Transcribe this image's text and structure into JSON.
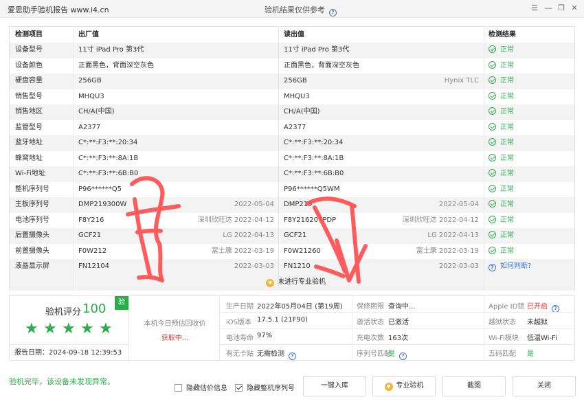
{
  "window": {
    "title": "爱思助手验机报告 www.i4.cn",
    "center_text": "验机结果仅供参考"
  },
  "table": {
    "headers": [
      "检测项目",
      "出厂值",
      "读出值",
      "检测结果"
    ],
    "rows": [
      {
        "item": "设备型号",
        "factory": "11寸 iPad Pro 第3代",
        "factory_sub": "",
        "read": "11寸 iPad Pro 第3代",
        "read_sub": "",
        "result": "正常",
        "status": "ok"
      },
      {
        "item": "设备颜色",
        "factory": "正面黑色，背面深空灰色",
        "factory_sub": "",
        "read": "正面黑色，背面深空灰色",
        "read_sub": "",
        "result": "正常",
        "status": "ok"
      },
      {
        "item": "硬盘容量",
        "factory": "256GB",
        "factory_sub": "",
        "read": "256GB",
        "read_sub": "Hynix TLC",
        "result": "正常",
        "status": "ok"
      },
      {
        "item": "销售型号",
        "factory": "MHQU3",
        "factory_sub": "",
        "read": "MHQU3",
        "read_sub": "",
        "result": "正常",
        "status": "ok"
      },
      {
        "item": "销售地区",
        "factory": "CH/A(中国)",
        "factory_sub": "",
        "read": "CH/A(中国)",
        "read_sub": "",
        "result": "正常",
        "status": "ok"
      },
      {
        "item": "监管型号",
        "factory": "A2377",
        "factory_sub": "",
        "read": "A2377",
        "read_sub": "",
        "result": "正常",
        "status": "ok"
      },
      {
        "item": "蓝牙地址",
        "factory": "C*:**:F3:**:20:34",
        "factory_sub": "",
        "read": "C*:**:F3:**:20:34",
        "read_sub": "",
        "result": "正常",
        "status": "ok"
      },
      {
        "item": "蜂窝地址",
        "factory": "C*:**:F3:**:8A:1B",
        "factory_sub": "",
        "read": "C*:**:F3:**:8A:1B",
        "read_sub": "",
        "result": "正常",
        "status": "ok"
      },
      {
        "item": "Wi-Fi地址",
        "factory": "C*:**:F3:**:6B:B0",
        "factory_sub": "",
        "read": "C*:**:F3:**:6B:B0",
        "read_sub": "",
        "result": "正常",
        "status": "ok"
      },
      {
        "item": "整机序列号",
        "factory": "P96******Q5",
        "factory_sub": "",
        "read": "P96******Q5WM",
        "read_sub": "",
        "result": "正常",
        "status": "ok"
      },
      {
        "item": "主板序列号",
        "factory": "DMP219300W",
        "factory_sub": "2022-05-04",
        "read": "DMP219",
        "read_sub": "2022-05-04",
        "result": "正常",
        "status": "ok"
      },
      {
        "item": "电池序列号",
        "factory": "F8Y216",
        "factory_sub": "深圳欣旺达 2022-04-12",
        "read": "F8Y216207PDP",
        "read_sub": "深圳欣旺达 2022-04-12",
        "result": "正常",
        "status": "ok"
      },
      {
        "item": "后置摄像头",
        "factory": "GCF21",
        "factory_sub": "LG 2022-04-13",
        "read": "GCF21",
        "read_sub": "LG 2022-04-13",
        "result": "正常",
        "status": "ok"
      },
      {
        "item": "前置摄像头",
        "factory": "F0W212",
        "factory_sub": "富士康 2022-03-19",
        "read": "F0W21260",
        "read_sub": "富士康 2022-03-19",
        "result": "正常",
        "status": "ok"
      },
      {
        "item": "液晶显示屏",
        "factory": "FN12104",
        "factory_sub": "2022-03-03",
        "read": "FN1210",
        "read_sub": "2022-03-03",
        "result": "如何判断?",
        "status": "unknown"
      }
    ],
    "footer_note": "未进行专业验机"
  },
  "summary": {
    "score_label": "验机评分",
    "score": "100",
    "badge": "验",
    "stars": 5,
    "report_date_label": "报告日期：",
    "report_date": "2024-09-18 12:39:53",
    "recycle_label": "本机今日预估回收价",
    "recycle_value": "获取中...",
    "details": [
      {
        "k": "生产日期",
        "v": "2022年05月04日 (第19周)"
      },
      {
        "k": "保修期限",
        "v": "查询中..."
      },
      {
        "k": "Apple ID锁",
        "v": "已开启"
      },
      {
        "k": "iOS版本",
        "v": "17.5.1 (21F90)"
      },
      {
        "k": "激活状态",
        "v": "已激活"
      },
      {
        "k": "越狱状态",
        "v": "未越狱"
      },
      {
        "k": "电池寿命",
        "v": "97%"
      },
      {
        "k": "充电次数",
        "v": "163次"
      },
      {
        "k": "Wi-Fi模块",
        "v": "低温Wi-Fi"
      },
      {
        "k": "有无卡贴",
        "v": "无需检测"
      },
      {
        "k": "序列号匹配",
        "v": "是"
      },
      {
        "k": "五码匹配",
        "v": "是"
      }
    ]
  },
  "bottom": {
    "status_text": "验机完毕，该设备未发现异常。",
    "hide_price_label": "隐藏估价信息",
    "hide_serial_label": "隐藏整机序列号",
    "btn_save": "一键入库",
    "btn_pro": "专业验机",
    "btn_shot": "截图",
    "btn_close": "关闭"
  },
  "colors": {
    "ok_green": "#2bae4a",
    "warn_red": "#e0352b",
    "link_blue": "#3a78d8",
    "scribble": "#ff4b4b"
  }
}
